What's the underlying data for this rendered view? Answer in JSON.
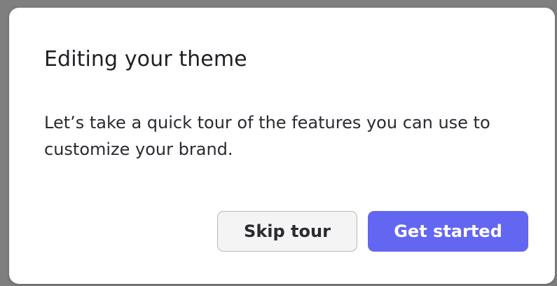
{
  "dialog": {
    "title": "Editing your theme",
    "body": "Let’s take a quick tour of the features you can use to customize your brand.",
    "skip_label": "Skip tour",
    "start_label": "Get started"
  },
  "colors": {
    "primary": "#6366f1",
    "secondary_bg": "#f4f4f5",
    "text": "#1f1f24"
  }
}
